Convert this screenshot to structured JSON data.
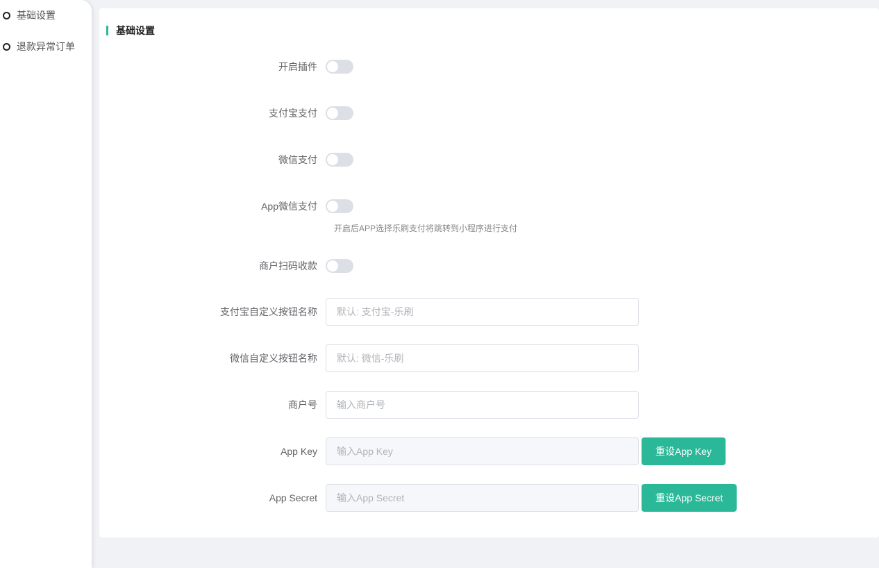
{
  "sidebar": {
    "items": [
      {
        "label": "基础设置"
      },
      {
        "label": "退款异常订单"
      }
    ]
  },
  "section_title": "基础设置",
  "switches": [
    {
      "label": "开启插件",
      "on": false
    },
    {
      "label": "支付宝支付",
      "on": false
    },
    {
      "label": "微信支付",
      "on": false
    },
    {
      "label": "App微信支付",
      "on": false
    },
    {
      "label": "商户扫码收款",
      "on": false
    }
  ],
  "app_wechat_hint": "开启后APP选择乐刷支付将跳转到小程序进行支付",
  "fields": [
    {
      "label": "支付宝自定义按钮名称",
      "placeholder": "默认: 支付宝-乐刷",
      "value": ""
    },
    {
      "label": "微信自定义按钮名称",
      "placeholder": "默认: 微信-乐刷",
      "value": ""
    },
    {
      "label": "商户号",
      "placeholder": "输入商户号",
      "value": ""
    },
    {
      "label": "App Key",
      "placeholder": "输入App Key",
      "value": "",
      "button": "重设App Key"
    },
    {
      "label": "App Secret",
      "placeholder": "输入App Secret",
      "value": "",
      "button": "重设App Secret"
    }
  ],
  "colors": {
    "accent": "#2bb898"
  }
}
